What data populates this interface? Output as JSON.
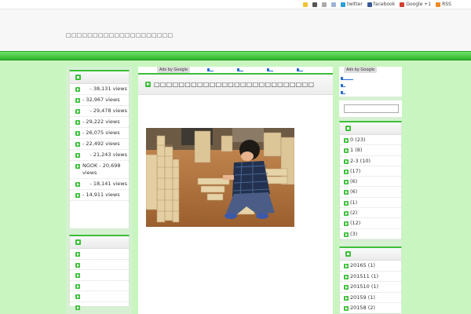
{
  "topbar": {
    "links": [
      {
        "label": "twitter",
        "color": "#2b9fd9"
      },
      {
        "label": "facebook",
        "color": "#3b5998"
      },
      {
        "label": "Google +1",
        "color": "#d23f31"
      },
      {
        "label": "RSS",
        "color": "#f08a24"
      }
    ]
  },
  "header": {
    "title": "□□□□□□□□□□□□□□□□□□□□"
  },
  "ads_label": "Ads by Google",
  "main": {
    "post_title": "□□□□□□□□□□□□□□□□□□□□□□□□□□"
  },
  "left_rank": [
    {
      "prefix": "",
      "text": "- 38,131 views"
    },
    {
      "prefix": "",
      "text": "- 32,967 views"
    },
    {
      "prefix": "",
      "text": "- 29,478 views"
    },
    {
      "prefix": "",
      "text": "- 29,222 views"
    },
    {
      "prefix": "",
      "text": "- 26,075 views"
    },
    {
      "prefix": "",
      "text": "- 22,492 views"
    },
    {
      "prefix": "",
      "text": "- 21,243 views"
    },
    {
      "prefix": "NGOK",
      "text": "- 20,698 views"
    },
    {
      "prefix": "",
      "text": "- 18,141 views"
    },
    {
      "prefix": "",
      "text": "- 14,911 views"
    }
  ],
  "left_blank_count": 6,
  "right_categories": [
    {
      "label": "0 (23)"
    },
    {
      "label": "1 (8)"
    },
    {
      "label": "2-3 (10)"
    },
    {
      "label": "(17)"
    },
    {
      "label": "(6)"
    },
    {
      "label": "(6)"
    },
    {
      "label": "(1)"
    },
    {
      "label": "(2)"
    },
    {
      "label": "(12)"
    },
    {
      "label": "(3)"
    }
  ],
  "right_archives": [
    {
      "label": "20165 (1)"
    },
    {
      "label": "201511 (1)"
    },
    {
      "label": "201510 (1)"
    },
    {
      "label": "20159 (1)"
    },
    {
      "label": "20158 (2)"
    }
  ]
}
